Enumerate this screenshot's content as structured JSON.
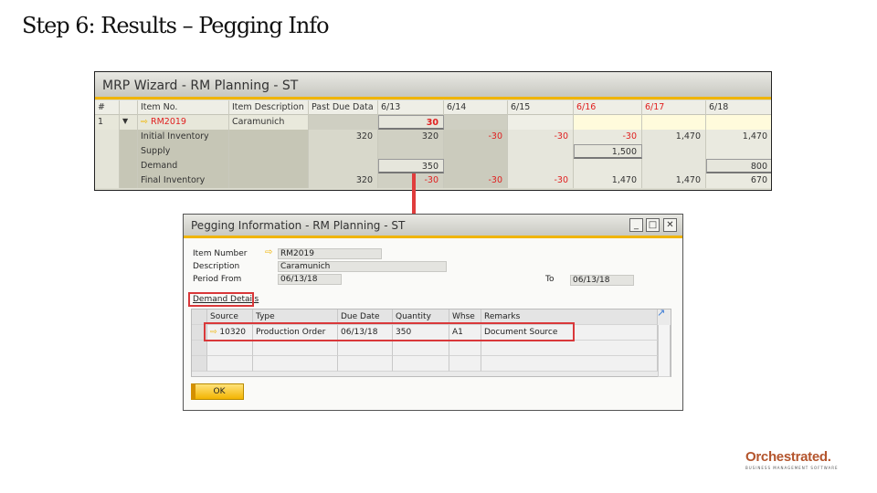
{
  "slide_title": "Step 6: Results – Pegging Info",
  "mrp": {
    "title": "MRP Wizard - RM Planning - ST",
    "columns": [
      "#",
      "",
      "Item No.",
      "Item Description",
      "Past Due Data",
      "6/13",
      "6/14",
      "6/15",
      "6/16",
      "6/17",
      "6/18"
    ],
    "item_row": {
      "num": "1",
      "item_no": "RM2019",
      "description": "Caramunich",
      "d613": "30"
    },
    "rows": [
      {
        "label": "Initial Inventory",
        "past_due": "320",
        "values": [
          "320",
          "-30",
          "-30",
          "-30",
          "1,470",
          "1,470"
        ]
      },
      {
        "label": "Supply",
        "past_due": "",
        "values": [
          "",
          "",
          "",
          "1,500",
          "",
          ""
        ]
      },
      {
        "label": "Demand",
        "past_due": "",
        "values": [
          "350",
          "",
          "",
          "",
          "",
          "800"
        ]
      },
      {
        "label": "Final Inventory",
        "past_due": "320",
        "values": [
          "-30",
          "-30",
          "-30",
          "1,470",
          "1,470",
          "670"
        ]
      }
    ]
  },
  "pegging": {
    "title": "Pegging Information - RM Planning - ST",
    "item_number_label": "Item Number",
    "item_number": "RM2019",
    "description_label": "Description",
    "description": "Caramunich",
    "period_from_label": "Period From",
    "period_from": "06/13/18",
    "to_label": "To",
    "period_to": "06/13/18",
    "demand_details": "Demand Details",
    "columns": [
      "Source",
      "Type",
      "Due Date",
      "Quantity",
      "Whse",
      "Remarks"
    ],
    "row": {
      "source": "10320",
      "type": "Production Order",
      "due_date": "06/13/18",
      "quantity": "350",
      "whse": "A1",
      "remarks": "Document Source"
    },
    "ok_label": "OK"
  },
  "logo": {
    "name": "Orchestrated.",
    "tagline": "BUSINESS MANAGEMENT SOFTWARE"
  },
  "colors": {
    "accent": "#f0b400",
    "highlight": "#d9383a",
    "negative": "#e02020",
    "brand": "#b4552d"
  }
}
